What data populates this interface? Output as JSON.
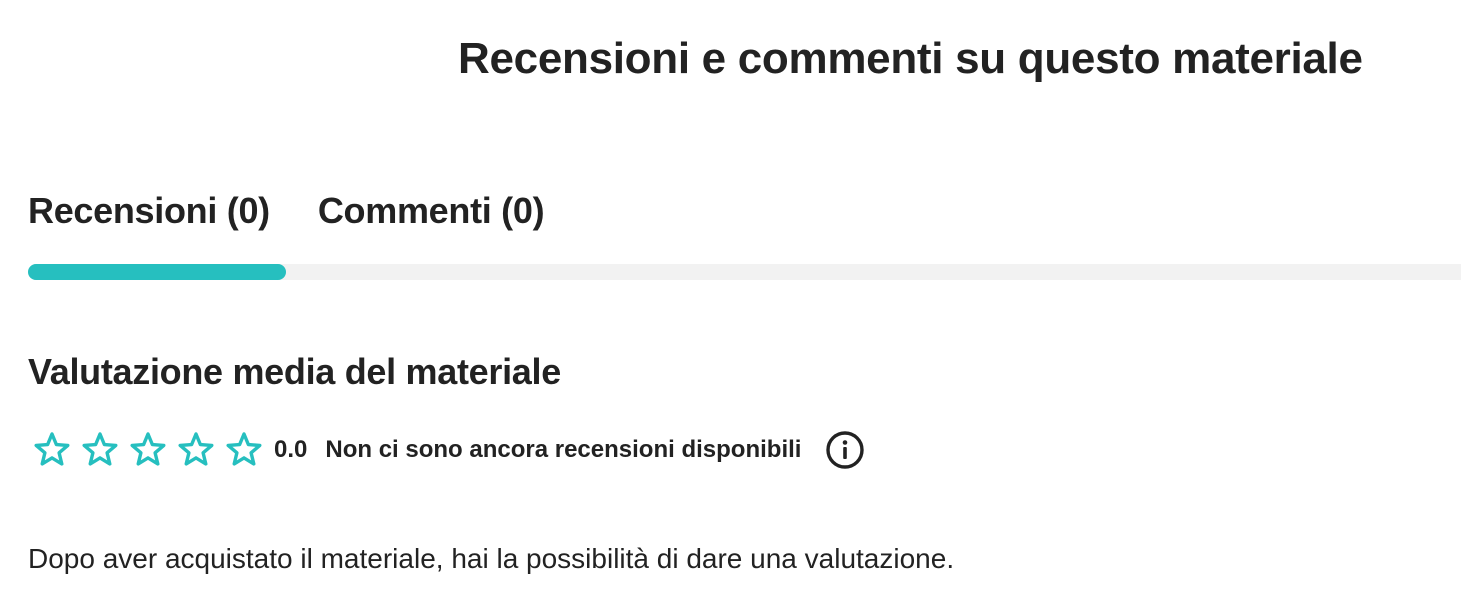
{
  "page_title": "Recensioni e commenti su questo materiale",
  "tabs": [
    {
      "label": "Recensioni (0)",
      "active": true
    },
    {
      "label": "Commenti (0)",
      "active": false
    }
  ],
  "colors": {
    "accent": "#26bfbf",
    "text": "#222222",
    "track": "#f2f2f2"
  },
  "rating": {
    "section_title": "Valutazione media del materiale",
    "value": "0.0",
    "stars_filled": 0,
    "stars_total": 5,
    "status_text": "Non ci sono ancora recensioni disponibili",
    "info_icon": "info-icon"
  },
  "note": "Dopo aver acquistato il materiale, hai la possibilità di dare una valutazione."
}
